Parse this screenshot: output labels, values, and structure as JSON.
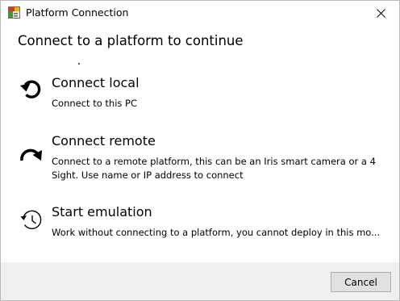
{
  "window": {
    "title": "Platform Connection",
    "app_icon": "app-logo-icon",
    "close_icon": "close-icon"
  },
  "heading": "Connect to a platform to continue",
  "options": [
    {
      "title": "Connect local",
      "description": "Connect to this PC",
      "icon": "rotate-left-arrow-icon"
    },
    {
      "title": "Connect remote",
      "description": "Connect to a remote platform, this can be an Iris smart camera or a 4 Sight. Use name or IP address to connect",
      "icon": "redo-arrow-icon"
    },
    {
      "title": "Start emulation",
      "description": "Work without connecting to a platform, you cannot deploy in this mo...",
      "icon": "history-icon"
    }
  ],
  "footer": {
    "cancel_label": "Cancel"
  },
  "colors": {
    "footer_bg": "#f0f0f0",
    "button_bg": "#e1e1e1",
    "button_border": "#adadad"
  }
}
